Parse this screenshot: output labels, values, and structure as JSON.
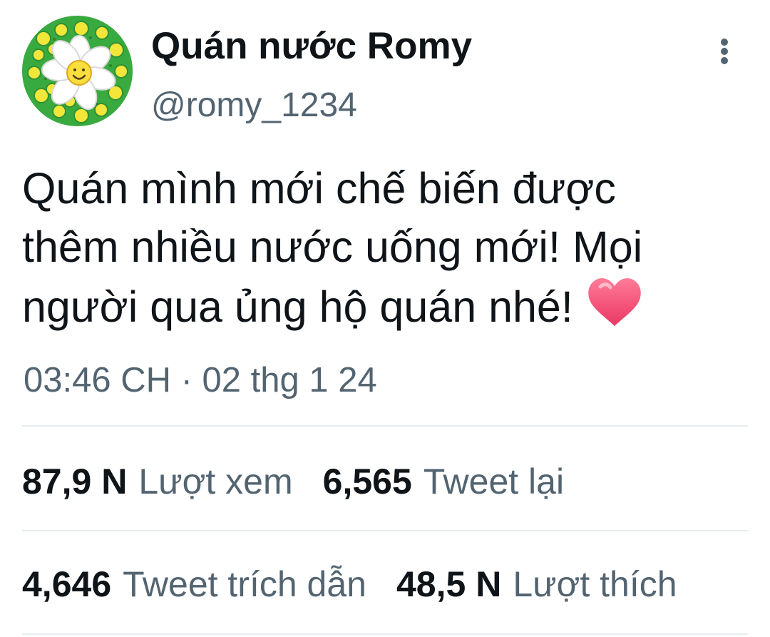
{
  "author": {
    "name": "Quán nước Romy",
    "handle": "@romy_1234",
    "avatar_icon": "daisy-avatar-icon"
  },
  "actions": {
    "more_icon": "more-options-icon"
  },
  "tweet": {
    "lines": [
      "Quán mình mới chế biến được",
      "thêm nhiều nước uống mới! Mọi",
      "người qua ủng hộ quán nhé!"
    ],
    "emoji": "❤️"
  },
  "timestamp": "03:46 CH · 02 thg 1 24",
  "stats": [
    {
      "value": "87,9 N",
      "label": "Lượt xem"
    },
    {
      "value": "6,565",
      "label": "Tweet lại"
    },
    {
      "value": "4,646",
      "label": "Tweet trích dẫn"
    },
    {
      "value": "48,5 N",
      "label": "Lượt thích"
    }
  ],
  "colors": {
    "text": "#0f1419",
    "secondary_text": "#536471",
    "divider": "#e7ecf0",
    "heart": "#f4567a",
    "avatar_green": "#36a83c",
    "avatar_yellow": "#f2e63b"
  }
}
